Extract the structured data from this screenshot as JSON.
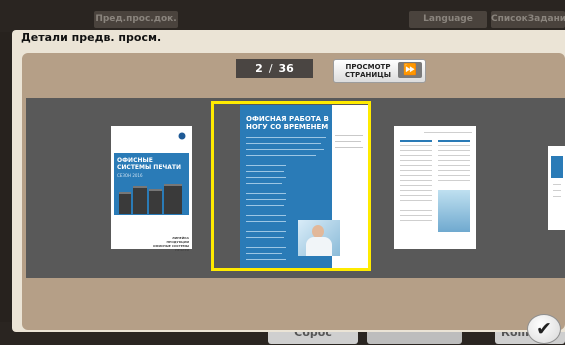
{
  "background": {
    "tabs": [
      "Пред.прос.док.",
      "Language",
      "СписокЗаданий"
    ],
    "bottom_buttons": [
      "Сброс",
      "Копир"
    ]
  },
  "dialog": {
    "title": "Детали предв. просм.",
    "page_current": "2",
    "page_separator": "/",
    "page_total": "36",
    "view_button": {
      "line1": "ПРОСМОТР",
      "line2": "СТРАНИЦЫ",
      "arrow": "⏩"
    },
    "confirm_icon": "✔"
  },
  "thumbnails": [
    {
      "title": "ОФИСНЫЕ СИСТЕМЫ ПЕЧАТИ",
      "subtitle": "ЛИНЕЙКА ПРОДУКЦИИ",
      "year": "СЕЗОН 2016",
      "footer1": "ЛИНЕЙКА ПРОДУКЦИИ",
      "footer2": "ОФИСНЫЕ СИСТЕМЫ ПЕЧАТИ"
    },
    {
      "title": "ОФИСНАЯ РАБОТА В НОГУ СО ВРЕМЕНЕМ",
      "selected": true
    },
    {
      "title": "table-page"
    },
    {
      "title": "partial-page"
    }
  ]
}
